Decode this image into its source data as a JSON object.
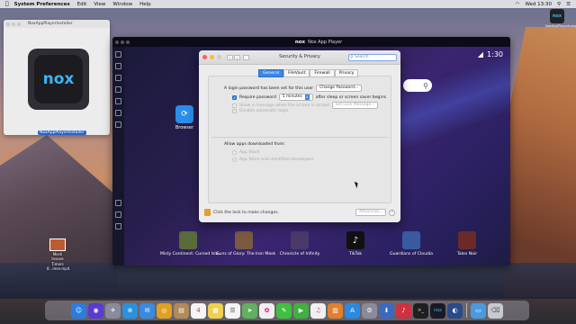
{
  "menubar": {
    "app": "System Preferences",
    "items": [
      "Edit",
      "View",
      "Window",
      "Help"
    ],
    "clock": "Wed 13:30"
  },
  "installer": {
    "title": "NoxAppPlayerInstaller",
    "icon_text": "nox",
    "file_label": "NoxAppPlayerInstaller"
  },
  "desktop": {
    "file_label_1": "Mesh Insane",
    "file_label_2": "Timers 8...imer.mp4",
    "nox_icon_text": "nox",
    "nox_label": "NoxAppPlayerInstaller"
  },
  "nox": {
    "title_logo": "nox",
    "title": "Nox App Player",
    "time": "1:30",
    "browser_label": "Browser",
    "apps": [
      {
        "label": "Misty Continent: Cursed Isla..",
        "color": "#5a6a3a"
      },
      {
        "label": "Guns of Glory: The Iron Mask",
        "color": "#7a5a40"
      },
      {
        "label": "Chronicle of Infinity",
        "color": "#4a3a6a"
      },
      {
        "label": "TikTok",
        "color": "#111111"
      },
      {
        "label": "Guardians of Cloudia",
        "color": "#3a5aa0"
      },
      {
        "label": "Tales Noir",
        "color": "#6a2a2a"
      }
    ]
  },
  "security": {
    "title": "Security & Privacy",
    "search_placeholder": "Search",
    "tabs": [
      "General",
      "FileVault",
      "Firewall",
      "Privacy"
    ],
    "password_set_text": "A login password has been set for this user",
    "change_password_btn": "Change Password...",
    "require_password_label": "Require password",
    "require_password_value": "5 minutes",
    "after_sleep_text": "after sleep or screen saver begins",
    "show_message_label": "Show a message when the screen is locked",
    "set_lock_message_btn": "Set Lock Message...",
    "disable_auto_login_label": "Disable automatic login",
    "allow_apps_label": "Allow apps downloaded from:",
    "option_app_store": "App Store",
    "option_identified": "App Store and identified developers",
    "lock_text": "Click the lock to make changes.",
    "advanced_btn": "Advanced...",
    "help": "?"
  },
  "dock": {
    "icons": [
      {
        "name": "finder-icon",
        "color": "#2a7de0",
        "glyph": "☺"
      },
      {
        "name": "siri-icon",
        "color": "#5a3ad0",
        "glyph": "◉"
      },
      {
        "name": "launchpad-icon",
        "color": "#8a8a9a",
        "glyph": "✈"
      },
      {
        "name": "safari-icon",
        "color": "#2a90e0",
        "glyph": "⊕"
      },
      {
        "name": "mail-icon",
        "color": "#3a8ae0",
        "glyph": "✉"
      },
      {
        "name": "chrome-icon",
        "color": "#e0a020",
        "glyph": "◎"
      },
      {
        "name": "contacts-icon",
        "color": "#b08a5a",
        "glyph": "▤"
      },
      {
        "name": "calendar-icon",
        "color": "#f4f4f4",
        "glyph": "4"
      },
      {
        "name": "notes-icon",
        "color": "#f0d050",
        "glyph": "▦"
      },
      {
        "name": "reminders-icon",
        "color": "#f4f4f4",
        "glyph": "☰"
      },
      {
        "name": "maps-icon",
        "color": "#60b060",
        "glyph": "➤"
      },
      {
        "name": "photos-icon",
        "color": "#f0f0f0",
        "glyph": "✿"
      },
      {
        "name": "messages-icon",
        "color": "#40c040",
        "glyph": "✎"
      },
      {
        "name": "facetime-icon",
        "color": "#40b040",
        "glyph": "▶"
      },
      {
        "name": "itunes-icon",
        "color": "#f0f0f0",
        "glyph": "♫"
      },
      {
        "name": "books-icon",
        "color": "#e08030",
        "glyph": "▥"
      },
      {
        "name": "appstore-icon",
        "color": "#2a8ae0",
        "glyph": "A"
      },
      {
        "name": "system-prefs-icon",
        "color": "#8a8a9a",
        "glyph": "⚙"
      },
      {
        "name": "downloads-icon",
        "color": "#3a6ac0",
        "glyph": "⬇"
      },
      {
        "name": "headphones-icon",
        "color": "#d03040",
        "glyph": "♪"
      },
      {
        "name": "terminal-icon",
        "color": "#202020",
        "glyph": ">_"
      },
      {
        "name": "nox-icon",
        "color": "#1a1a24",
        "glyph": "nox"
      },
      {
        "name": "multiplayer-icon",
        "color": "#2a4a8a",
        "glyph": "◐"
      },
      {
        "name": "folder-icon",
        "color": "#4a9ae0",
        "glyph": "▭"
      },
      {
        "name": "trash-icon",
        "color": "#c8c8d0",
        "glyph": "🗑"
      }
    ]
  },
  "colors": {
    "accent": "#3b86e6",
    "nox_bg": "#1c1d3a"
  }
}
